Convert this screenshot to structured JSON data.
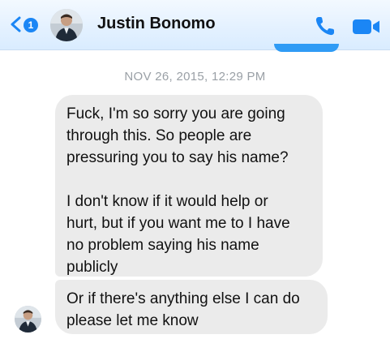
{
  "header": {
    "unread_count": "1",
    "contact_name": "Justin Bonomo",
    "accent_color": "#1b86f5"
  },
  "icons": {
    "back": "chevron-left-icon",
    "call": "phone-icon",
    "video": "video-camera-icon"
  },
  "conversation": {
    "timestamp": "NOV 26, 2015, 12:29 PM",
    "messages": [
      {
        "from": "Justin Bonomo",
        "paragraphs": [
          "Fuck, I'm so sorry you are going\nthrough this. So people are\npressuring you to say his name?",
          "I don't know if it would help or\nhurt, but if you want me to I have\nno problem saying his name\npublicly"
        ]
      },
      {
        "from": "Justin Bonomo",
        "paragraphs": [
          "Or if there's anything else I can do\nplease let me know"
        ]
      }
    ]
  }
}
